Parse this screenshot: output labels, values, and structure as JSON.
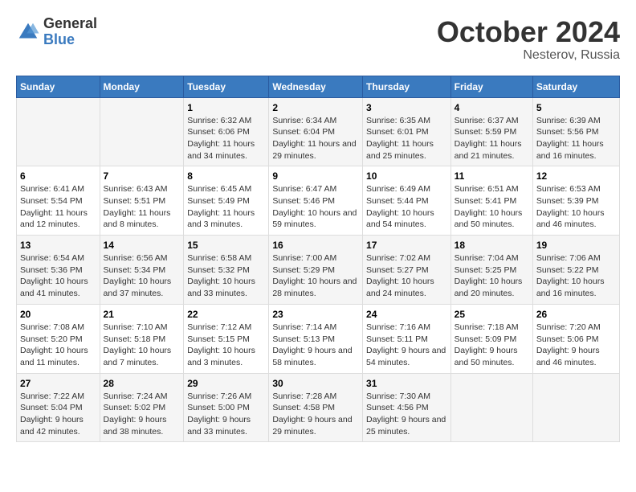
{
  "header": {
    "logo_general": "General",
    "logo_blue": "Blue",
    "month": "October 2024",
    "location": "Nesterov, Russia"
  },
  "weekdays": [
    "Sunday",
    "Monday",
    "Tuesday",
    "Wednesday",
    "Thursday",
    "Friday",
    "Saturday"
  ],
  "weeks": [
    [
      {
        "day": "",
        "info": ""
      },
      {
        "day": "",
        "info": ""
      },
      {
        "day": "1",
        "info": "Sunrise: 6:32 AM\nSunset: 6:06 PM\nDaylight: 11 hours and 34 minutes."
      },
      {
        "day": "2",
        "info": "Sunrise: 6:34 AM\nSunset: 6:04 PM\nDaylight: 11 hours and 29 minutes."
      },
      {
        "day": "3",
        "info": "Sunrise: 6:35 AM\nSunset: 6:01 PM\nDaylight: 11 hours and 25 minutes."
      },
      {
        "day": "4",
        "info": "Sunrise: 6:37 AM\nSunset: 5:59 PM\nDaylight: 11 hours and 21 minutes."
      },
      {
        "day": "5",
        "info": "Sunrise: 6:39 AM\nSunset: 5:56 PM\nDaylight: 11 hours and 16 minutes."
      }
    ],
    [
      {
        "day": "6",
        "info": "Sunrise: 6:41 AM\nSunset: 5:54 PM\nDaylight: 11 hours and 12 minutes."
      },
      {
        "day": "7",
        "info": "Sunrise: 6:43 AM\nSunset: 5:51 PM\nDaylight: 11 hours and 8 minutes."
      },
      {
        "day": "8",
        "info": "Sunrise: 6:45 AM\nSunset: 5:49 PM\nDaylight: 11 hours and 3 minutes."
      },
      {
        "day": "9",
        "info": "Sunrise: 6:47 AM\nSunset: 5:46 PM\nDaylight: 10 hours and 59 minutes."
      },
      {
        "day": "10",
        "info": "Sunrise: 6:49 AM\nSunset: 5:44 PM\nDaylight: 10 hours and 54 minutes."
      },
      {
        "day": "11",
        "info": "Sunrise: 6:51 AM\nSunset: 5:41 PM\nDaylight: 10 hours and 50 minutes."
      },
      {
        "day": "12",
        "info": "Sunrise: 6:53 AM\nSunset: 5:39 PM\nDaylight: 10 hours and 46 minutes."
      }
    ],
    [
      {
        "day": "13",
        "info": "Sunrise: 6:54 AM\nSunset: 5:36 PM\nDaylight: 10 hours and 41 minutes."
      },
      {
        "day": "14",
        "info": "Sunrise: 6:56 AM\nSunset: 5:34 PM\nDaylight: 10 hours and 37 minutes."
      },
      {
        "day": "15",
        "info": "Sunrise: 6:58 AM\nSunset: 5:32 PM\nDaylight: 10 hours and 33 minutes."
      },
      {
        "day": "16",
        "info": "Sunrise: 7:00 AM\nSunset: 5:29 PM\nDaylight: 10 hours and 28 minutes."
      },
      {
        "day": "17",
        "info": "Sunrise: 7:02 AM\nSunset: 5:27 PM\nDaylight: 10 hours and 24 minutes."
      },
      {
        "day": "18",
        "info": "Sunrise: 7:04 AM\nSunset: 5:25 PM\nDaylight: 10 hours and 20 minutes."
      },
      {
        "day": "19",
        "info": "Sunrise: 7:06 AM\nSunset: 5:22 PM\nDaylight: 10 hours and 16 minutes."
      }
    ],
    [
      {
        "day": "20",
        "info": "Sunrise: 7:08 AM\nSunset: 5:20 PM\nDaylight: 10 hours and 11 minutes."
      },
      {
        "day": "21",
        "info": "Sunrise: 7:10 AM\nSunset: 5:18 PM\nDaylight: 10 hours and 7 minutes."
      },
      {
        "day": "22",
        "info": "Sunrise: 7:12 AM\nSunset: 5:15 PM\nDaylight: 10 hours and 3 minutes."
      },
      {
        "day": "23",
        "info": "Sunrise: 7:14 AM\nSunset: 5:13 PM\nDaylight: 9 hours and 58 minutes."
      },
      {
        "day": "24",
        "info": "Sunrise: 7:16 AM\nSunset: 5:11 PM\nDaylight: 9 hours and 54 minutes."
      },
      {
        "day": "25",
        "info": "Sunrise: 7:18 AM\nSunset: 5:09 PM\nDaylight: 9 hours and 50 minutes."
      },
      {
        "day": "26",
        "info": "Sunrise: 7:20 AM\nSunset: 5:06 PM\nDaylight: 9 hours and 46 minutes."
      }
    ],
    [
      {
        "day": "27",
        "info": "Sunrise: 7:22 AM\nSunset: 5:04 PM\nDaylight: 9 hours and 42 minutes."
      },
      {
        "day": "28",
        "info": "Sunrise: 7:24 AM\nSunset: 5:02 PM\nDaylight: 9 hours and 38 minutes."
      },
      {
        "day": "29",
        "info": "Sunrise: 7:26 AM\nSunset: 5:00 PM\nDaylight: 9 hours and 33 minutes."
      },
      {
        "day": "30",
        "info": "Sunrise: 7:28 AM\nSunset: 4:58 PM\nDaylight: 9 hours and 29 minutes."
      },
      {
        "day": "31",
        "info": "Sunrise: 7:30 AM\nSunset: 4:56 PM\nDaylight: 9 hours and 25 minutes."
      },
      {
        "day": "",
        "info": ""
      },
      {
        "day": "",
        "info": ""
      }
    ]
  ]
}
